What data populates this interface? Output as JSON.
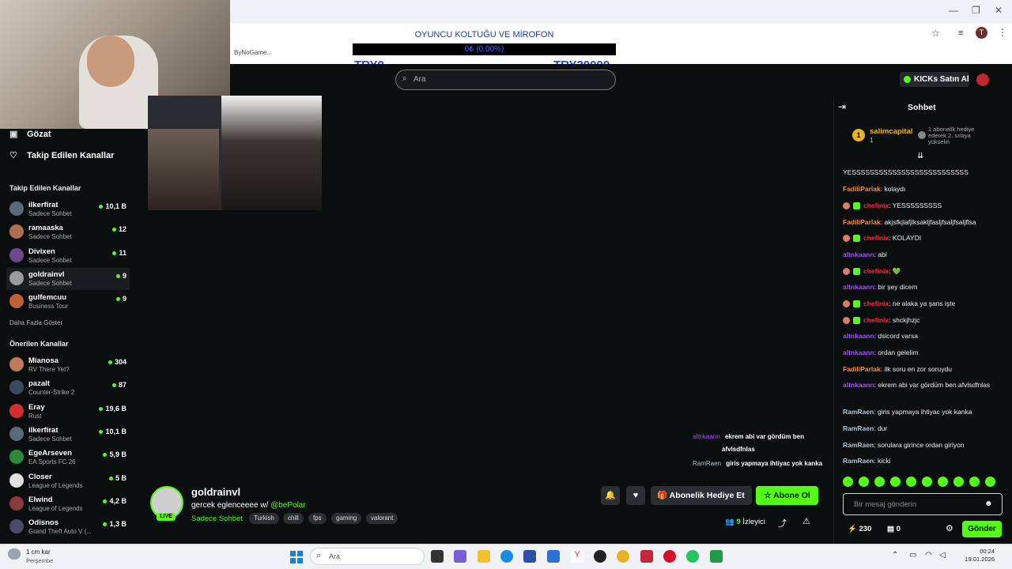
{
  "overlay": {
    "goal_title": "OYUNCU KOLTUĞU VE MİROFON",
    "goal_progress": "0₺ (0.00%)",
    "goal_min": "TRY0",
    "goal_max": "TRY20000",
    "progress_fraction": 0.0
  },
  "browser": {
    "bookmark": "ByNoGame..."
  },
  "header": {
    "search_placeholder": "Ara",
    "buy_kicks": "KICKs Satın Al"
  },
  "sidebar": {
    "nav": [
      {
        "label": "Gözat",
        "icon": "browse-icon"
      },
      {
        "label": "Takip Edilen Kanallar",
        "icon": "heart-icon"
      }
    ],
    "followed_title": "Takip Edilen Kanallar",
    "followed": [
      {
        "name": "ilkerfirat",
        "category": "Sadece Sohbet",
        "viewers": "10,1 B",
        "color": "#5a6a7a"
      },
      {
        "name": "ramaaska",
        "category": "Sadece Sohbet",
        "viewers": "12",
        "color": "#b07050"
      },
      {
        "name": "Divixen",
        "category": "Sadece Sohbet",
        "viewers": "11",
        "color": "#6a4a8a"
      },
      {
        "name": "goldrainvl",
        "category": "Sadece Sohbet",
        "viewers": "9",
        "color": "#9a9a9a"
      },
      {
        "name": "gulfemcuu",
        "category": "Business Tour",
        "viewers": "9",
        "color": "#c0603a"
      }
    ],
    "more_label": "Daha Fazla Göster",
    "recommended_title": "Önerilen Kanallar",
    "recommended": [
      {
        "name": "Mianosa",
        "category": "RV There Yet?",
        "viewers": "304",
        "color": "#c07a5a"
      },
      {
        "name": "pazalt",
        "category": "Counter-Strike 2",
        "viewers": "87",
        "color": "#3a4a5a"
      },
      {
        "name": "Eray",
        "category": "Rust",
        "viewers": "19,6 B",
        "color": "#d03030"
      },
      {
        "name": "ilkerfirat",
        "category": "Sadece Sohbet",
        "viewers": "10,1 B",
        "color": "#5a6a7a"
      },
      {
        "name": "EgeArseven",
        "category": "EA Sports FC 26",
        "viewers": "5,9 B",
        "color": "#2a8a3a"
      },
      {
        "name": "Closer",
        "category": "League of Legends",
        "viewers": "5 B",
        "color": "#e0e0e0"
      },
      {
        "name": "Elwind",
        "category": "League of Legends",
        "viewers": "4,2 B",
        "color": "#8a3a3a"
      },
      {
        "name": "Odisnos",
        "category": "Grand Theft Auto V (...",
        "viewers": "1,3 B",
        "color": "#4a4a6a"
      }
    ]
  },
  "video_overlay": [
    {
      "user": "altnkaann",
      "text": "ekrem abi var gördüm ben",
      "cont": "afvlsdfnlas",
      "color": "#a64dff"
    },
    {
      "user": "RamRaen",
      "text": "giris yapmaya ihtiyac yok kanka",
      "cont": "",
      "color": "#b0c4de"
    }
  ],
  "stream": {
    "name": "goldrainvl",
    "title": "gercek eglenceeee w/ ",
    "mention": "@bePolar",
    "live": "LIVE",
    "category": "Sadece Sohbet",
    "tags": [
      "Turkish",
      "chill",
      "fps",
      "gaming",
      "valorant"
    ],
    "gift_label": "Abonelik Hediye Et",
    "subscribe_label": "Abone Ol",
    "viewers": "9",
    "viewers_label": "İzleyici"
  },
  "chat": {
    "title": "Sohbet",
    "pinned": {
      "rank": "1",
      "user": "salimcapital",
      "count": "1",
      "text": "1 abonelik hediye ederek 2. sıraya yükseliń"
    },
    "messages": [
      {
        "user": "",
        "text": "YESSSSSSSSSSSSSSSSSSSSSSSSSS",
        "color": "#ff3b3b",
        "badges": false
      },
      {
        "user": "FadiliParlak",
        "text": "kolaydı",
        "color": "#ff8c42",
        "badges": false
      },
      {
        "user": "chefinix",
        "text": "YESSSSSSSSS",
        "color": "#ff2b3b",
        "badges": true
      },
      {
        "user": "FadiliParlak",
        "text": "akjsfkjlafjlksakljfasljfsaljfsaljflsa",
        "color": "#ff8c42",
        "badges": false
      },
      {
        "user": "chefinix",
        "text": "KOLAYDI",
        "color": "#ff2b3b",
        "badges": true
      },
      {
        "user": "altnkaann",
        "text": "abi",
        "color": "#a64dff",
        "badges": false
      },
      {
        "user": "chefinix",
        "text": "💚",
        "color": "#ff2b3b",
        "badges": true
      },
      {
        "user": "altnkaann",
        "text": "bir şey dicem",
        "color": "#a64dff",
        "badges": false
      },
      {
        "user": "chefinix",
        "text": "ne alaka ya şans işte",
        "color": "#ff2b3b",
        "badges": true
      },
      {
        "user": "chefinix",
        "text": "shckjhzjc",
        "color": "#ff2b3b",
        "badges": true
      },
      {
        "user": "altnkaann",
        "text": "dsicord varsa",
        "color": "#a64dff",
        "badges": false
      },
      {
        "user": "altnkaann",
        "text": "ordan gelelim",
        "color": "#a64dff",
        "badges": false
      },
      {
        "user": "FadiliParlak",
        "text": "ilk soru en zor soruydu",
        "color": "#ff8c42",
        "badges": false
      },
      {
        "user": "altnkaann",
        "text": "ekrem abi var gördüm ben afvlsdfnlas",
        "color": "#a64dff",
        "badges": false
      },
      {
        "user": "RamRaen",
        "text": "giris yapmaya ihtiyac yok kanka",
        "color": "#b0c4de",
        "badges": false
      },
      {
        "user": "RamRaen",
        "text": "dur",
        "color": "#b0c4de",
        "badges": false
      },
      {
        "user": "RamRaen",
        "text": "sorulara girince ordan girlyon",
        "color": "#b0c4de",
        "badges": false
      },
      {
        "user": "RamRaen",
        "text": "kicki",
        "color": "#b0c4de",
        "badges": false
      }
    ],
    "input_placeholder": "Bir mesaj gönderin",
    "kicks": "230",
    "gifts": "0",
    "send_label": "Gönder"
  },
  "taskbar": {
    "weather_title": "1 cm kar",
    "weather_sub": "Perşembe",
    "search": "Ara",
    "time": "00:24",
    "date": "19.01.2026"
  },
  "colors": {
    "accent": "#53fc18",
    "background": "#0b0e0f"
  }
}
